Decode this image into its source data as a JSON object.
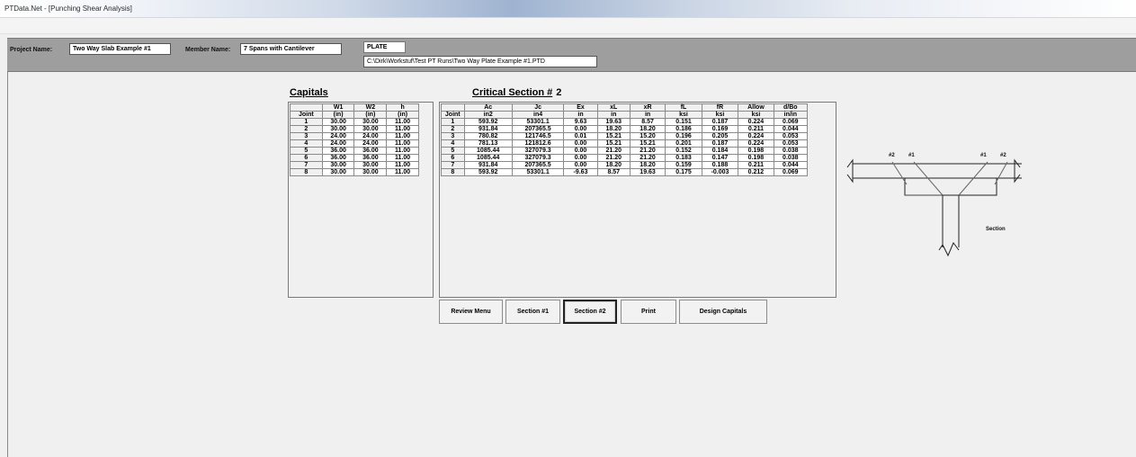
{
  "window": {
    "title": "PTData.Net - [Punching Shear Analysis]"
  },
  "info": {
    "project_label": "Project Name:",
    "project_value": "Two Way Slab Example #1",
    "member_label": "Member Name:",
    "member_value": "7 Spans with Cantilever",
    "type_value": "PLATE",
    "file_path": "C:\\Dirk\\Workstuf\\Test PT Runs\\Two Way Plate Example #1.PTD"
  },
  "capitals": {
    "heading": "Capitals",
    "header1": [
      "",
      "W1",
      "W2",
      "h"
    ],
    "header2": [
      "Joint",
      "(in)",
      "(in)",
      "(in)"
    ],
    "rows": [
      [
        "1",
        "30.00",
        "30.00",
        "11.00"
      ],
      [
        "2",
        "30.00",
        "30.00",
        "11.00"
      ],
      [
        "3",
        "24.00",
        "24.00",
        "11.00"
      ],
      [
        "4",
        "24.00",
        "24.00",
        "11.00"
      ],
      [
        "5",
        "36.00",
        "36.00",
        "11.00"
      ],
      [
        "6",
        "36.00",
        "36.00",
        "11.00"
      ],
      [
        "7",
        "30.00",
        "30.00",
        "11.00"
      ],
      [
        "8",
        "30.00",
        "30.00",
        "11.00"
      ]
    ]
  },
  "critical": {
    "heading": "Critical Section #",
    "number": "2",
    "header1": [
      "",
      "Ac",
      "Jc",
      "Ex",
      "xL",
      "xR",
      "fL",
      "fR",
      "Allow",
      "d/Bo"
    ],
    "header2": [
      "Joint",
      "in2",
      "in4",
      "in",
      "in",
      "in",
      "ksi",
      "ksi",
      "ksi",
      "in/in"
    ],
    "rows": [
      [
        "1",
        "593.92",
        "53301.1",
        "9.63",
        "19.63",
        "8.57",
        "0.151",
        "0.187",
        "0.224",
        "0.069"
      ],
      [
        "2",
        "931.84",
        "207365.5",
        "0.00",
        "18.20",
        "18.20",
        "0.186",
        "0.169",
        "0.211",
        "0.044"
      ],
      [
        "3",
        "780.82",
        "121746.5",
        "0.01",
        "15.21",
        "15.20",
        "0.196",
        "0.205",
        "0.224",
        "0.053"
      ],
      [
        "4",
        "781.13",
        "121812.6",
        "0.00",
        "15.21",
        "15.21",
        "0.201",
        "0.187",
        "0.224",
        "0.053"
      ],
      [
        "5",
        "1085.44",
        "327079.3",
        "0.00",
        "21.20",
        "21.20",
        "0.152",
        "0.184",
        "0.198",
        "0.038"
      ],
      [
        "6",
        "1085.44",
        "327079.3",
        "0.00",
        "21.20",
        "21.20",
        "0.183",
        "0.147",
        "0.198",
        "0.038"
      ],
      [
        "7",
        "931.84",
        "207365.5",
        "0.00",
        "18.20",
        "18.20",
        "0.159",
        "0.188",
        "0.211",
        "0.044"
      ],
      [
        "8",
        "593.92",
        "53301.1",
        "-9.63",
        "8.57",
        "19.63",
        "0.175",
        "-0.003",
        "0.212",
        "0.069"
      ]
    ]
  },
  "buttons": {
    "review_menu": "Review Menu",
    "section1": "Section #1",
    "section2": "Section #2",
    "print": "Print",
    "design_capitals": "Design Capitals"
  },
  "diagram": {
    "labels": [
      "#2",
      "#1",
      "#1",
      "#2"
    ],
    "section_label": "Section"
  }
}
